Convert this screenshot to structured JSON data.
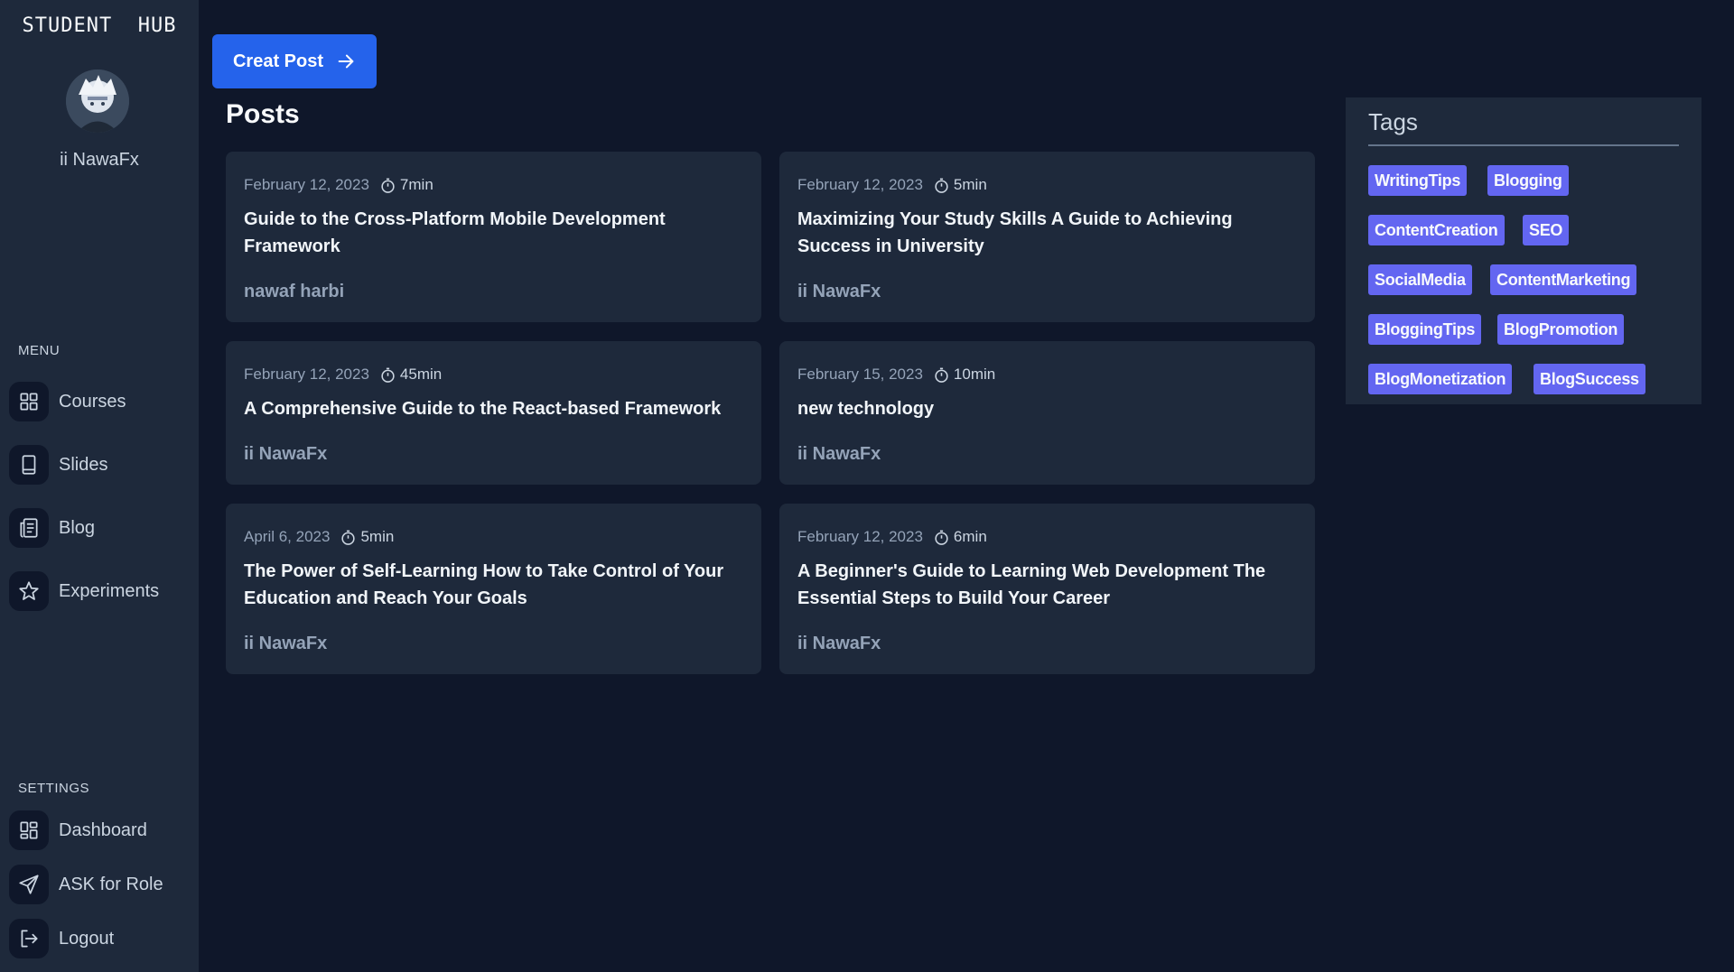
{
  "brand": "STUDENT  HUB",
  "user": {
    "name": "ii NawaFx"
  },
  "menu": {
    "label": "MENU",
    "items": [
      {
        "label": "Courses",
        "icon": "grid-icon"
      },
      {
        "label": "Slides",
        "icon": "tablet-icon"
      },
      {
        "label": "Blog",
        "icon": "newspaper-icon"
      },
      {
        "label": "Experiments",
        "icon": "star-icon"
      }
    ]
  },
  "settings": {
    "label": "SETTINGS",
    "items": [
      {
        "label": "Dashboard",
        "icon": "dashboard-icon"
      },
      {
        "label": "ASK for Role",
        "icon": "send-icon"
      },
      {
        "label": "Logout",
        "icon": "logout-icon"
      }
    ]
  },
  "create_button": {
    "label": "Creat Post",
    "icon": "arrow-right-icon"
  },
  "posts": {
    "title": "Posts",
    "items": [
      {
        "date": "February 12, 2023",
        "duration": "7min",
        "title": "Guide to the Cross-Platform Mobile Development Framework",
        "author": "nawaf harbi"
      },
      {
        "date": "February 12, 2023",
        "duration": "5min",
        "title": "Maximizing Your Study Skills A Guide to Achieving Success in University",
        "author": "ii NawaFx"
      },
      {
        "date": "February 12, 2023",
        "duration": "45min",
        "title": "A Comprehensive Guide to the React-based Framework",
        "author": "ii NawaFx"
      },
      {
        "date": "February 15, 2023",
        "duration": "10min",
        "title": "new technology",
        "author": "ii NawaFx"
      },
      {
        "date": "April 6, 2023",
        "duration": "5min",
        "title": "The Power of Self-Learning How to Take Control of Your Education and Reach Your Goals",
        "author": "ii NawaFx"
      },
      {
        "date": "February 12, 2023",
        "duration": "6min",
        "title": "A Beginner's Guide to Learning Web Development The Essential Steps to Build Your Career",
        "author": "ii NawaFx"
      }
    ]
  },
  "tags": {
    "title": "Tags",
    "items": [
      "WritingTips",
      "Blogging",
      "ContentCreation",
      "SEO",
      "SocialMedia",
      "ContentMarketing",
      "BloggingTips",
      "BlogPromotion",
      "BlogMonetization",
      "BlogSuccess"
    ]
  },
  "colors": {
    "background": "#0f172a",
    "sidebar": "#1e293b",
    "card": "#1e293b",
    "primary_button": "#2563eb",
    "tag": "#6366f1"
  }
}
